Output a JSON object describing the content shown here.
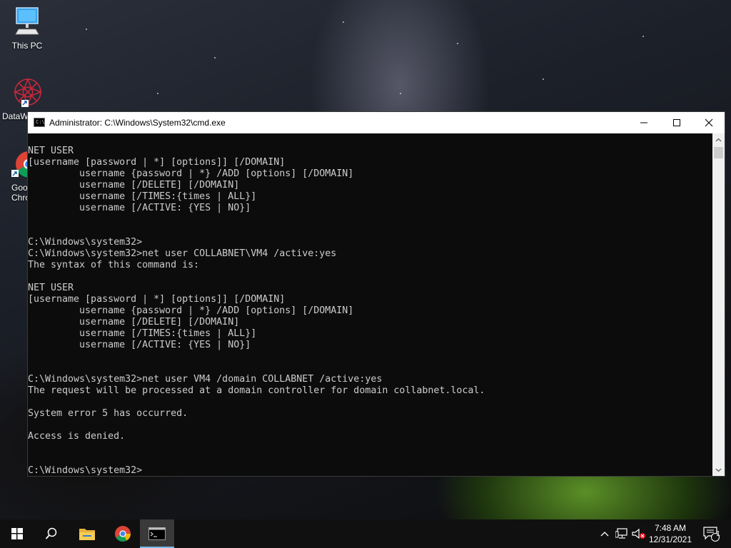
{
  "desktop": {
    "icons": [
      {
        "label": "This PC"
      },
      {
        "label": "DataW"
      },
      {
        "label": "Goo\nChro"
      }
    ]
  },
  "window": {
    "title": "Administrator: C:\\Windows\\System32\\cmd.exe",
    "icon_text": "C:\\_",
    "console_lines": [
      "NET USER",
      "[username [password | *] [options]] [/DOMAIN]",
      "         username {password | *} /ADD [options] [/DOMAIN]",
      "         username [/DELETE] [/DOMAIN]",
      "         username [/TIMES:{times | ALL}]",
      "         username [/ACTIVE: {YES | NO}]",
      "",
      "",
      "C:\\Windows\\system32>",
      "C:\\Windows\\system32>net user COLLABNET\\VM4 /active:yes",
      "The syntax of this command is:",
      "",
      "NET USER",
      "[username [password | *] [options]] [/DOMAIN]",
      "         username {password | *} /ADD [options] [/DOMAIN]",
      "         username [/DELETE] [/DOMAIN]",
      "         username [/TIMES:{times | ALL}]",
      "         username [/ACTIVE: {YES | NO}]",
      "",
      "",
      "C:\\Windows\\system32>net user VM4 /domain COLLABNET /active:yes",
      "The request will be processed at a domain controller for domain collabnet.local.",
      "",
      "System error 5 has occurred.",
      "",
      "Access is denied.",
      "",
      "",
      "C:\\Windows\\system32>"
    ]
  },
  "taskbar": {
    "time": "7:48 AM",
    "date": "12/31/2021",
    "notification_count": "1"
  },
  "colors": {
    "console_bg": "#0c0c0c",
    "console_fg": "#cccccc",
    "taskbar_bg": "#101010",
    "accent": "#76b9ed"
  }
}
